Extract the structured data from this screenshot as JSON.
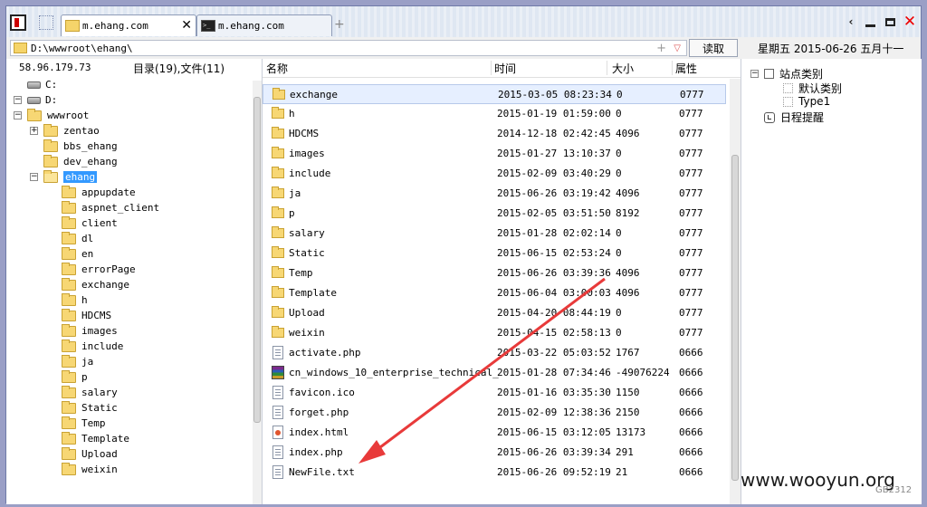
{
  "tabs": [
    {
      "label": "m.ehang.com",
      "icon": "folder",
      "active": true
    },
    {
      "label": "m.ehang.com",
      "icon": "terminal",
      "active": false
    }
  ],
  "address": {
    "path": "D:\\wwwroot\\ehang\\",
    "read_button": "读取",
    "date_info": "星期五 2015-06-26 五月十一"
  },
  "left_panel": {
    "ip": "58.96.179.73",
    "summary": "目录(19),文件(11)",
    "tree": [
      {
        "label": "C:",
        "type": "drive",
        "level": 0
      },
      {
        "label": "D:",
        "type": "drive",
        "level": 0,
        "expander": "−"
      },
      {
        "label": "wwwroot",
        "type": "folder",
        "level": 1,
        "expander": "−"
      },
      {
        "label": "zentao",
        "type": "folder",
        "level": 2,
        "expander": "+"
      },
      {
        "label": "bbs_ehang",
        "type": "folder",
        "level": 2
      },
      {
        "label": "dev_ehang",
        "type": "folder",
        "level": 2
      },
      {
        "label": "ehang",
        "type": "folder",
        "level": 2,
        "expander": "−",
        "selected": true
      },
      {
        "label": "appupdate",
        "type": "folder",
        "level": 3
      },
      {
        "label": "aspnet_client",
        "type": "folder",
        "level": 3
      },
      {
        "label": "client",
        "type": "folder",
        "level": 3
      },
      {
        "label": "dl",
        "type": "folder",
        "level": 3
      },
      {
        "label": "en",
        "type": "folder",
        "level": 3
      },
      {
        "label": "errorPage",
        "type": "folder",
        "level": 3
      },
      {
        "label": "exchange",
        "type": "folder",
        "level": 3
      },
      {
        "label": "h",
        "type": "folder",
        "level": 3
      },
      {
        "label": "HDCMS",
        "type": "folder",
        "level": 3
      },
      {
        "label": "images",
        "type": "folder",
        "level": 3
      },
      {
        "label": "include",
        "type": "folder",
        "level": 3
      },
      {
        "label": "ja",
        "type": "folder",
        "level": 3
      },
      {
        "label": "p",
        "type": "folder",
        "level": 3
      },
      {
        "label": "salary",
        "type": "folder",
        "level": 3
      },
      {
        "label": "Static",
        "type": "folder",
        "level": 3
      },
      {
        "label": "Temp",
        "type": "folder",
        "level": 3
      },
      {
        "label": "Template",
        "type": "folder",
        "level": 3
      },
      {
        "label": "Upload",
        "type": "folder",
        "level": 3
      },
      {
        "label": "weixin",
        "type": "folder",
        "level": 3
      }
    ]
  },
  "file_list": {
    "columns": [
      "名称",
      "时间",
      "大小",
      "属性"
    ],
    "rows": [
      {
        "name": "exchange",
        "time": "2015-03-05 08:23:34",
        "size": "0",
        "attr": "0777",
        "type": "folder",
        "selected": true
      },
      {
        "name": "h",
        "time": "2015-01-19 01:59:00",
        "size": "0",
        "attr": "0777",
        "type": "folder"
      },
      {
        "name": "HDCMS",
        "time": "2014-12-18 02:42:45",
        "size": "4096",
        "attr": "0777",
        "type": "folder"
      },
      {
        "name": "images",
        "time": "2015-01-27 13:10:37",
        "size": "0",
        "attr": "0777",
        "type": "folder"
      },
      {
        "name": "include",
        "time": "2015-02-09 03:40:29",
        "size": "0",
        "attr": "0777",
        "type": "folder"
      },
      {
        "name": "ja",
        "time": "2015-06-26 03:19:42",
        "size": "4096",
        "attr": "0777",
        "type": "folder"
      },
      {
        "name": "p",
        "time": "2015-02-05 03:51:50",
        "size": "8192",
        "attr": "0777",
        "type": "folder"
      },
      {
        "name": "salary",
        "time": "2015-01-28 02:02:14",
        "size": "0",
        "attr": "0777",
        "type": "folder"
      },
      {
        "name": "Static",
        "time": "2015-06-15 02:53:24",
        "size": "0",
        "attr": "0777",
        "type": "folder"
      },
      {
        "name": "Temp",
        "time": "2015-06-26 03:39:36",
        "size": "4096",
        "attr": "0777",
        "type": "folder"
      },
      {
        "name": "Template",
        "time": "2015-06-04 03:00:03",
        "size": "4096",
        "attr": "0777",
        "type": "folder"
      },
      {
        "name": "Upload",
        "time": "2015-04-20 08:44:19",
        "size": "0",
        "attr": "0777",
        "type": "folder"
      },
      {
        "name": "weixin",
        "time": "2015-04-15 02:58:13",
        "size": "0",
        "attr": "0777",
        "type": "folder"
      },
      {
        "name": "activate.php",
        "time": "2015-03-22 05:03:52",
        "size": "1767",
        "attr": "0666",
        "type": "doc"
      },
      {
        "name": "cn_windows_10_enterprise_technical_",
        "time": "2015-01-28 07:34:46",
        "size": "-49076224",
        "attr": "0666",
        "type": "rar"
      },
      {
        "name": "favicon.ico",
        "time": "2015-01-16 03:35:30",
        "size": "1150",
        "attr": "0666",
        "type": "doc"
      },
      {
        "name": "forget.php",
        "time": "2015-02-09 12:38:36",
        "size": "2150",
        "attr": "0666",
        "type": "doc"
      },
      {
        "name": "index.html",
        "time": "2015-06-15 03:12:05",
        "size": "13173",
        "attr": "0666",
        "type": "html"
      },
      {
        "name": "index.php",
        "time": "2015-06-26 03:39:34",
        "size": "291",
        "attr": "0666",
        "type": "doc"
      },
      {
        "name": "NewFile.txt",
        "time": "2015-06-26 09:52:19",
        "size": "21",
        "attr": "0666",
        "type": "doc"
      }
    ]
  },
  "right_panel": {
    "items": [
      {
        "label": "站点类别",
        "level": 0,
        "expander": "−"
      },
      {
        "label": "默认类别",
        "level": 1
      },
      {
        "label": "Type1",
        "level": 1
      },
      {
        "label": "日程提醒",
        "level": 0
      }
    ]
  },
  "watermark": "www.wooyun.org",
  "encoding": "GB2312",
  "colors": {
    "selection": "#3399ff",
    "arrow": "#e83a3a",
    "folder": "#f7d774"
  }
}
